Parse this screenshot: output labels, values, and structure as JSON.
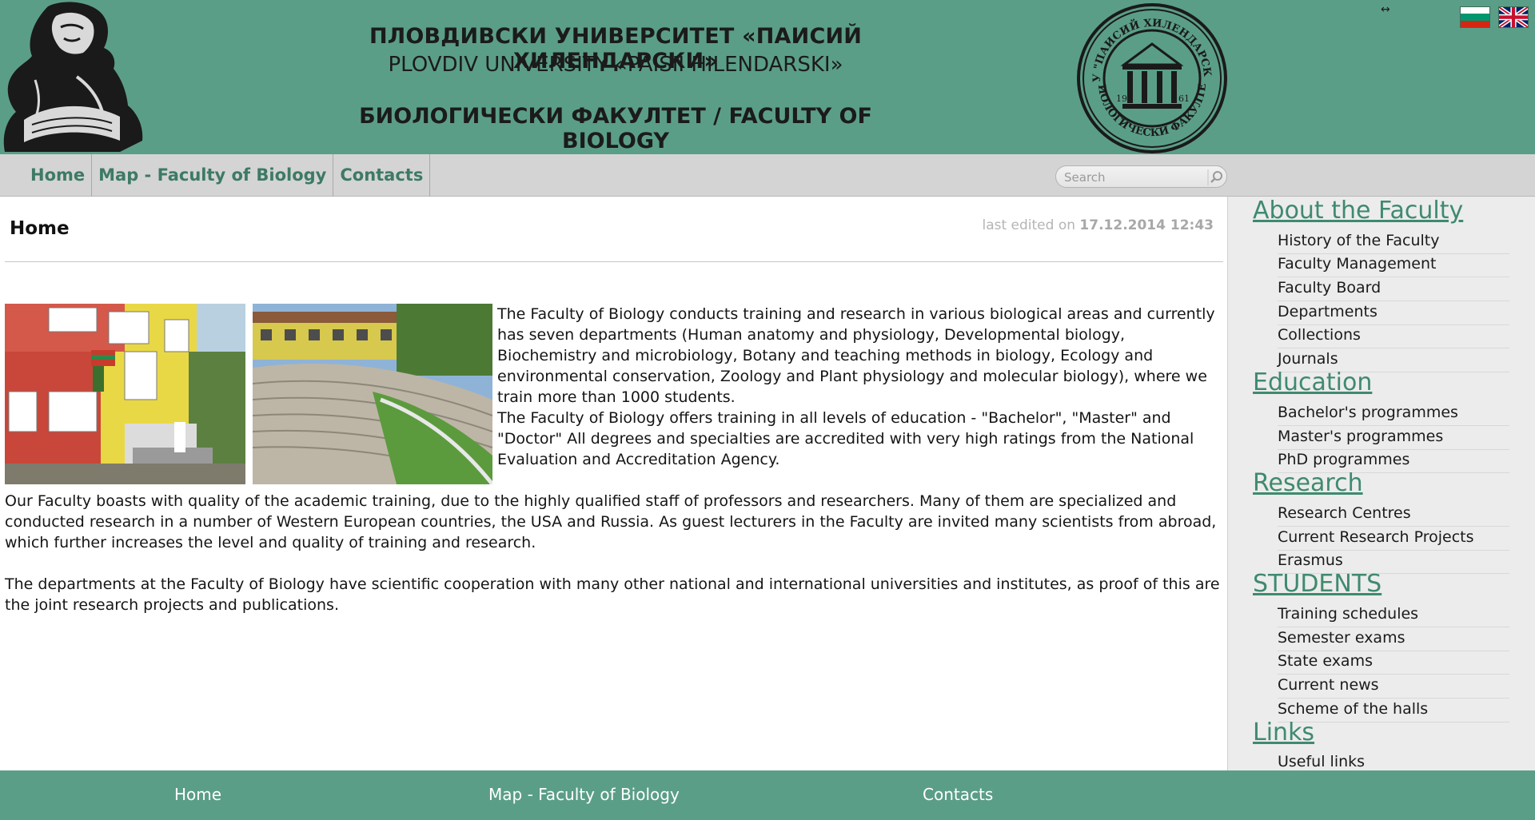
{
  "header": {
    "title_bg": "ПЛОВДИВСКИ УНИВЕРСИТЕТ «ПАИСИЙ ХИЛЕНДАРСКИ»",
    "title_en": "PLOVDIV UNIVERSITY «PAISII HILENDARSKI»",
    "faculty": "БИОЛОГИЧЕСКИ ФАКУЛТЕТ / FACULTY OF BIOLOGY",
    "seal": {
      "top_text": "ПУ \"ПАИСИЙ ХИЛЕНДАРСКИ\"",
      "bottom_text": "БИОЛОГИЧЕСКИ ФАКУЛТЕТ",
      "year_left": "19",
      "year_right": "61"
    },
    "resize_icon": "↔",
    "flags": [
      "bulgarian-flag-icon",
      "uk-flag-icon"
    ]
  },
  "nav": {
    "items": [
      "Home",
      "Map - Faculty of Biology",
      "Contacts"
    ],
    "search_placeholder": "Search"
  },
  "main": {
    "title": "Home",
    "edited_prefix": "last edited on",
    "edited_date": "17.12.2014 12:43",
    "paragraphs": [
      "The Faculty of Biology conducts training and research in various biological areas and currently has seven departments (Human anatomy and physiology, Developmental biology, Biochemistry and microbiology, Botany and teaching methods in biology, Ecology and environmental conservation, Zoology and Plant physiology and molecular biology), where we train more than 1000 students.",
      "The Faculty of Biology offers training in all levels of education - \"Bachelor\", \"Master\" and \"Doctor\" All degrees and specialties are accredited with very high ratings from the National Evaluation and Accreditation Agency.",
      "Our Faculty boasts with quality of the academic training, due to the highly qualified staff of professors and researchers. Many of them are specialized and conducted research in a number of Western European countries, the USA and Russia. As guest lecturers in the Faculty are invited many scientists from abroad, which further increases the level and quality of training and research.",
      "The departments at the Faculty of Biology have scientific cooperation with many other national and international universities and institutes, as proof of this are the joint research projects and publications."
    ]
  },
  "sidebar": {
    "sections": [
      {
        "title": "About the Faculty",
        "items": [
          "History of the Faculty",
          "Faculty Management",
          "Faculty Board",
          "Departments",
          "Collections",
          "Journals"
        ]
      },
      {
        "title": "Education",
        "items": [
          "Bachelor's programmes",
          "Master's programmes",
          "PhD programmes"
        ]
      },
      {
        "title": "Research",
        "items": [
          "Research Centres",
          "Current Research Projects",
          "Erasmus"
        ]
      },
      {
        "title": "STUDENTS",
        "items": [
          "Training schedules",
          "Semester exams",
          "State exams",
          "Current news",
          "Scheme of the halls"
        ]
      },
      {
        "title": "Links",
        "items": [
          "Useful links"
        ]
      }
    ]
  },
  "footer": {
    "links": [
      "Home",
      "Map - Faculty of Biology",
      "Contacts"
    ]
  },
  "colors": {
    "brand_green": "#5b9e87",
    "nav_link": "#3d7a64",
    "sidebar_link": "#3f8a6e"
  }
}
